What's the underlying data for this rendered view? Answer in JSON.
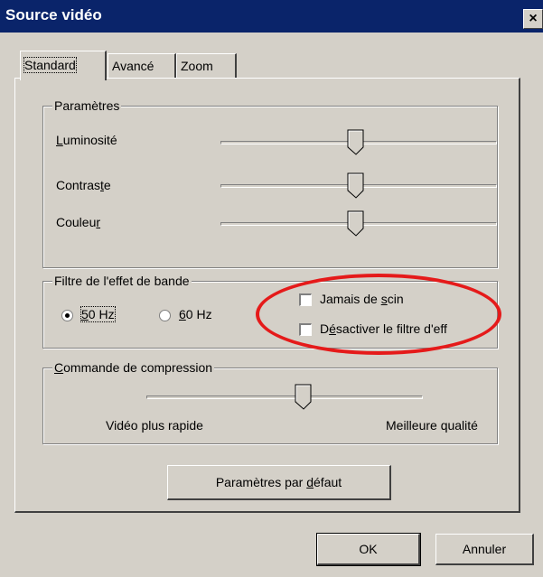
{
  "window": {
    "title": "Source vidéo",
    "close_label": "×"
  },
  "tabs": [
    {
      "label": "Standard",
      "active": true
    },
    {
      "label": "Avancé",
      "active": false
    },
    {
      "label": "Zoom",
      "active": false
    }
  ],
  "parametres": {
    "title": "Paramètres",
    "rows": [
      {
        "label_pre": "",
        "label_u": "L",
        "label_post": "uminosité",
        "value": 0.49
      },
      {
        "label_pre": "Contras",
        "label_u": "t",
        "label_post": "e",
        "value": 0.49
      },
      {
        "label_pre": "Couleu",
        "label_u": "r",
        "label_post": "",
        "value": 0.49
      }
    ]
  },
  "filtre": {
    "title": "Filtre de l'effet de bande",
    "radios": [
      {
        "label_u": "5",
        "label_post": "0 Hz",
        "checked": true
      },
      {
        "label_u": "6",
        "label_post": "0 Hz",
        "checked": false
      }
    ],
    "checkboxes": [
      {
        "label_pre": "Jamais de ",
        "label_u": "s",
        "label_post": "cin",
        "checked": false
      },
      {
        "label_pre": "D",
        "label_u": "é",
        "label_post": "sactiver le filtre d'eff",
        "checked": false
      }
    ]
  },
  "compression": {
    "title_u": "C",
    "title_post": "ommande de compression",
    "left_label": "Vidéo plus rapide",
    "right_label": "Meilleure qualité",
    "value": 0.57
  },
  "defaults_button": {
    "label_pre": "Paramètres par ",
    "label_u": "d",
    "label_post": "éfaut"
  },
  "footer": {
    "ok_label": "OK",
    "cancel_label": "Annuler"
  },
  "colors": {
    "titlebar": "#0a246a",
    "face": "#d4d0c8",
    "highlight_ellipse": "#e51a1a"
  }
}
